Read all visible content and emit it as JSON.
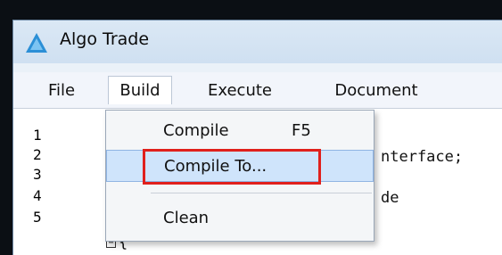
{
  "window": {
    "title": "Algo Trade",
    "icon": "algo-trade-logo-icon"
  },
  "menubar": {
    "items": [
      {
        "label": "File"
      },
      {
        "label": "Build"
      },
      {
        "label": "Execute"
      },
      {
        "label": "Document"
      }
    ],
    "active": "Build"
  },
  "editor": {
    "line_numbers": [
      "1",
      "2",
      "3",
      "4",
      "5"
    ],
    "visible_code": {
      "line2": "nterface;",
      "line4": "de",
      "line5_fold": "−",
      "line5_text": "{"
    }
  },
  "build_menu": {
    "items": [
      {
        "label": "Compile",
        "shortcut": "F5"
      },
      {
        "label": "Compile To...",
        "shortcut": ""
      },
      {
        "label": "Clean",
        "shortcut": ""
      }
    ],
    "highlighted": "Compile To..."
  },
  "colors": {
    "highlight_bg": "#cfe4fb",
    "focus_outline": "#e0201c",
    "menubar_bg": "#f2f5fb"
  }
}
